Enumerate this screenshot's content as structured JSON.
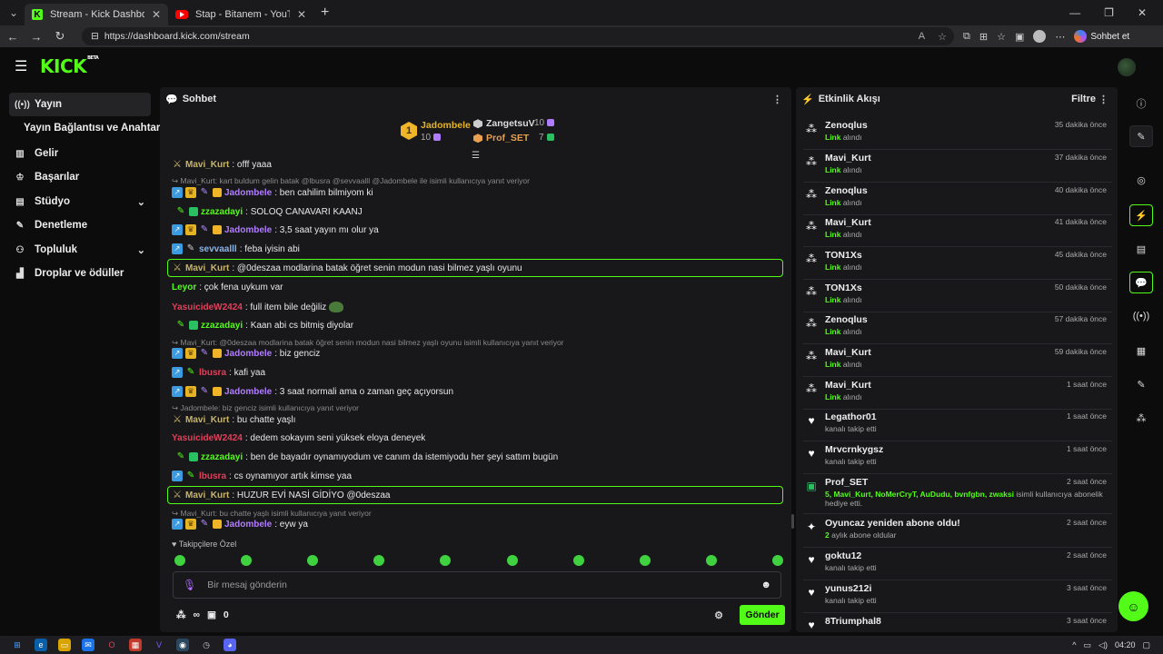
{
  "browser": {
    "tabs": [
      {
        "title": "Stream - Kick Dashboard",
        "active": true
      },
      {
        "title": "Stap - Bitanem - YouTube",
        "active": false
      }
    ],
    "url": "https://dashboard.kick.com/stream",
    "copilot_label": "Sohbet et"
  },
  "header": {
    "logo": "KICK",
    "beta": "BETA"
  },
  "sidebar": {
    "items": [
      {
        "label": "Yayın",
        "icon": "broadcast-icon"
      },
      {
        "label": "Yayın Bağlantısı ve Anahtarı",
        "icon": ""
      },
      {
        "label": "Gelir",
        "icon": "chart-icon"
      },
      {
        "label": "Başarılar",
        "icon": "trophy-icon"
      },
      {
        "label": "Stüdyo",
        "icon": "studio-icon"
      },
      {
        "label": "Denetleme",
        "icon": "wrench-icon"
      },
      {
        "label": "Topluluk",
        "icon": "people-icon"
      },
      {
        "label": "Droplar ve ödüller",
        "icon": "gift-icon"
      }
    ]
  },
  "chat": {
    "title": "Sohbet",
    "leaderboard": {
      "rank": "1",
      "first_name": "Jadombele",
      "first_count": "10",
      "second_name": "ZangetsuV",
      "second_count": "10",
      "third_name": "Prof_SET",
      "third_count": "7"
    },
    "messages": [
      {
        "user": "Mavi_Kurt",
        "text": ": offf yaaa"
      },
      {
        "reply": "Mavi_Kurt: kart buldum gelin batak @lbusra @sevvaalll @Jadombele ile isimli kullanıcıya yanıt veriyor"
      },
      {
        "user": "Jadombele",
        "text": ": ben cahilim bilmiyom ki"
      },
      {
        "user": "zzazadayi",
        "text": ": SOLOQ CANAVARI KAANJ"
      },
      {
        "user": "Jadombele",
        "text": ": 3,5 saat yayın mı olur ya"
      },
      {
        "user": "sevvaalll",
        "text": ": feba iyisin abi"
      },
      {
        "user": "Mavi_Kurt",
        "text": ": @0deszaa modlarina batak öğret senin modun nasi bilmez yaşlı oyunu"
      },
      {
        "user": "Leyor",
        "text": ": çok fena uykum var"
      },
      {
        "user": "YasuicideW2424",
        "text": ": full item bile değiliz"
      },
      {
        "user": "zzazadayi",
        "text": ": Kaan abi cs bitmiş diyolar"
      },
      {
        "reply": "Mavi_Kurt: @0deszaa modlarina batak öğret senin modun nasi bilmez yaşlı oyunu isimli kullanıcıya yanıt veriyor"
      },
      {
        "user": "Jadombele",
        "text": ": biz genciz"
      },
      {
        "user": "lbusra",
        "text": ": kafi yaa"
      },
      {
        "user": "Jadombele",
        "text": ": 3 saat normali ama o zaman geç açıyorsun"
      },
      {
        "reply": "Jadombele: biz genciz isimli kullanıcıya yanıt veriyor"
      },
      {
        "user": "Mavi_Kurt",
        "text": ": bu chatte yaşlı"
      },
      {
        "user": "YasuicideW2424",
        "text": ": dedem sokayım seni yüksek eloya deneyek"
      },
      {
        "user": "zzazadayi",
        "text": ": ben de bayadır oynamıyodum ve canım da istemiyodu her şeyi sattım bugün"
      },
      {
        "user": "lbusra",
        "text": ": cs oynamıyor artık kimse yaa"
      },
      {
        "user": "Mavi_Kurt",
        "text": ": HUZUR EVİ NASİ GİDİYO @0deszaa"
      },
      {
        "reply": "Mavi_Kurt: bu chatte yaşlı isimli kullanıcıya yanıt veriyor"
      },
      {
        "user": "Jadombele",
        "text": ": eyw ya"
      }
    ],
    "followers_only": "Takipçilere Özel",
    "input_placeholder": "Bir mesaj gönderin",
    "gift_count": "0",
    "send_label": "Gönder"
  },
  "feed": {
    "title": "Etkinlik Akışı",
    "filter_label": "Filtre",
    "items": [
      {
        "name": "Zenoqlus",
        "sub_g": "Link",
        "sub": " alındı",
        "time": "35 dakika önce",
        "icon": "share-icon"
      },
      {
        "name": "Mavi_Kurt",
        "sub_g": "Link",
        "sub": " alındı",
        "time": "37 dakika önce",
        "icon": "share-icon"
      },
      {
        "name": "Zenoqlus",
        "sub_g": "Link",
        "sub": " alındı",
        "time": "40 dakika önce",
        "icon": "share-icon"
      },
      {
        "name": "Mavi_Kurt",
        "sub_g": "Link",
        "sub": " alındı",
        "time": "41 dakika önce",
        "icon": "share-icon"
      },
      {
        "name": "TON1Xs",
        "sub_g": "Link",
        "sub": " alındı",
        "time": "45 dakika önce",
        "icon": "share-icon"
      },
      {
        "name": "TON1Xs",
        "sub_g": "Link",
        "sub": " alındı",
        "time": "50 dakika önce",
        "icon": "share-icon"
      },
      {
        "name": "Zenoqlus",
        "sub_g": "Link",
        "sub": " alındı",
        "time": "57 dakika önce",
        "icon": "share-icon"
      },
      {
        "name": "Mavi_Kurt",
        "sub_g": "Link",
        "sub": " alındı",
        "time": "59 dakika önce",
        "icon": "share-icon"
      },
      {
        "name": "Mavi_Kurt",
        "sub_g": "Link",
        "sub": " alındı",
        "time": "1 saat önce",
        "icon": "share-icon"
      },
      {
        "name": "Legathor01",
        "sub_g": "",
        "sub": "kanalı takip etti",
        "time": "1 saat önce",
        "icon": "heart-icon"
      },
      {
        "name": "Mrvcrnkygsz",
        "sub_g": "",
        "sub": "kanalı takip etti",
        "time": "1 saat önce",
        "icon": "heart-icon"
      },
      {
        "name": "Prof_SET",
        "sub_g": "5, Mavi_Kurt, NoMerCryT, AuDudu, bvnfgbn, zwaksi",
        "sub": " isimli kullanıcıya abonelik hediye etti.",
        "time": "2 saat önce",
        "icon": "gift-icon"
      },
      {
        "name": "Oyuncaz yeniden abone oldu!",
        "sub_g": "2",
        "sub": " aylık abone oldular",
        "time": "2 saat önce",
        "icon": "sparkle-icon"
      },
      {
        "name": "goktu12",
        "sub_g": "",
        "sub": "kanalı takip etti",
        "time": "2 saat önce",
        "icon": "heart-icon"
      },
      {
        "name": "yunus212i",
        "sub_g": "",
        "sub": "kanalı takip etti",
        "time": "3 saat önce",
        "icon": "heart-icon"
      },
      {
        "name": "8Triumphal8",
        "sub_g": "",
        "sub": "",
        "time": "3 saat önce",
        "icon": "heart-icon"
      }
    ]
  },
  "taskbar": {
    "time": "04:20"
  },
  "colors": {
    "accent": "#53fc18",
    "panel": "#18181b",
    "page": "#0c0c0d"
  }
}
